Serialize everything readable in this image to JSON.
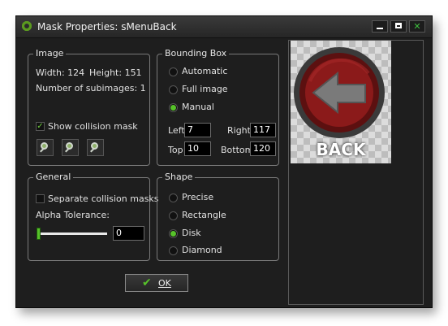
{
  "window": {
    "title": "Mask Properties: sMenuBack",
    "buttons": {
      "minimize": "minimize",
      "maximize": "maximize",
      "close": "✕"
    }
  },
  "image_group": {
    "label": "Image",
    "width_label": "Width: 124",
    "height_label": "Height: 151",
    "subimages_label": "Number of subimages: 1",
    "show_collision_mask_label": "Show collision mask",
    "show_collision_mask_checked": true
  },
  "bounding_box": {
    "label": "Bounding Box",
    "options": [
      "Automatic",
      "Full image",
      "Manual"
    ],
    "selected": "Manual",
    "left_label": "Left",
    "left_value": "7",
    "right_label": "Right",
    "right_value": "117",
    "top_label": "Top",
    "top_value": "10",
    "bottom_label": "Bottom",
    "bottom_value": "120"
  },
  "general": {
    "label": "General",
    "separate_masks_label": "Separate collision masks",
    "separate_masks_checked": false,
    "alpha_label": "Alpha Tolerance:",
    "alpha_value": "0"
  },
  "shape": {
    "label": "Shape",
    "options": [
      "Precise",
      "Rectangle",
      "Disk",
      "Diamond"
    ],
    "selected": "Disk"
  },
  "ok_button": {
    "label": "OK"
  },
  "preview": {
    "sprite_text": "BACK"
  },
  "colors": {
    "accent_green": "#57c22a",
    "window_bg": "#1e1e1e",
    "border": "#7a7a7a"
  }
}
